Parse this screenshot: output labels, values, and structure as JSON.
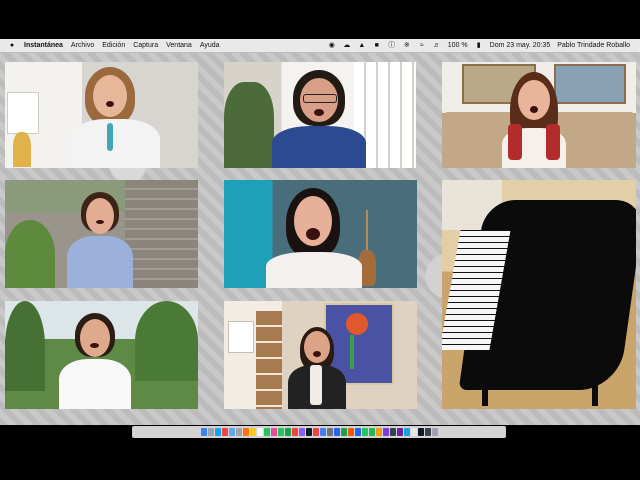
{
  "menubar": {
    "apple_icon": "apple-icon",
    "app_name": "Instantánea",
    "menus": [
      "Archivo",
      "Edición",
      "Captura",
      "Ventana",
      "Ayuda"
    ],
    "battery": "100 %",
    "date_time": "Dom 23 may.  20:35",
    "user": "Pablo Trindade Roballo"
  },
  "colors": {
    "menubar": "#e9e9e9",
    "desktop": "#c4c4c4",
    "dock": "#d4d4d4"
  },
  "tiles": [
    {
      "id": "singer-1",
      "background": "#e6e3df"
    },
    {
      "id": "singer-2",
      "background": "#f0eee9"
    },
    {
      "id": "singer-3",
      "background": "#a89274"
    },
    {
      "id": "singer-4",
      "background": "#7f8a72"
    },
    {
      "id": "singer-5",
      "background": "#4a6d7c"
    },
    {
      "id": "piano",
      "background": "#d9b98a"
    },
    {
      "id": "singer-6",
      "background": "#6f9a5a"
    },
    {
      "id": "singer-7",
      "background": "#e9e0d4"
    }
  ],
  "dock": {
    "icons": [
      "finder-icon",
      "launchpad-icon",
      "safari-icon",
      "chrome-icon",
      "mail-icon",
      "contacts-icon",
      "calendar-icon",
      "notes-icon",
      "reminders-icon",
      "maps-icon",
      "photos-icon",
      "messages-icon",
      "facetime-icon",
      "music-icon",
      "podcasts-icon",
      "tv-icon",
      "news-icon",
      "appstore-icon",
      "preferences-icon",
      "word-icon",
      "excel-icon",
      "powerpoint-icon",
      "zoom-icon",
      "whatsapp-icon",
      "spotify-icon",
      "garageband-icon",
      "imovie-icon",
      "logic-icon",
      "finalcut-icon",
      "preview-icon",
      "textedit-icon",
      "terminal-icon",
      "activity-icon",
      "trash-icon"
    ]
  }
}
